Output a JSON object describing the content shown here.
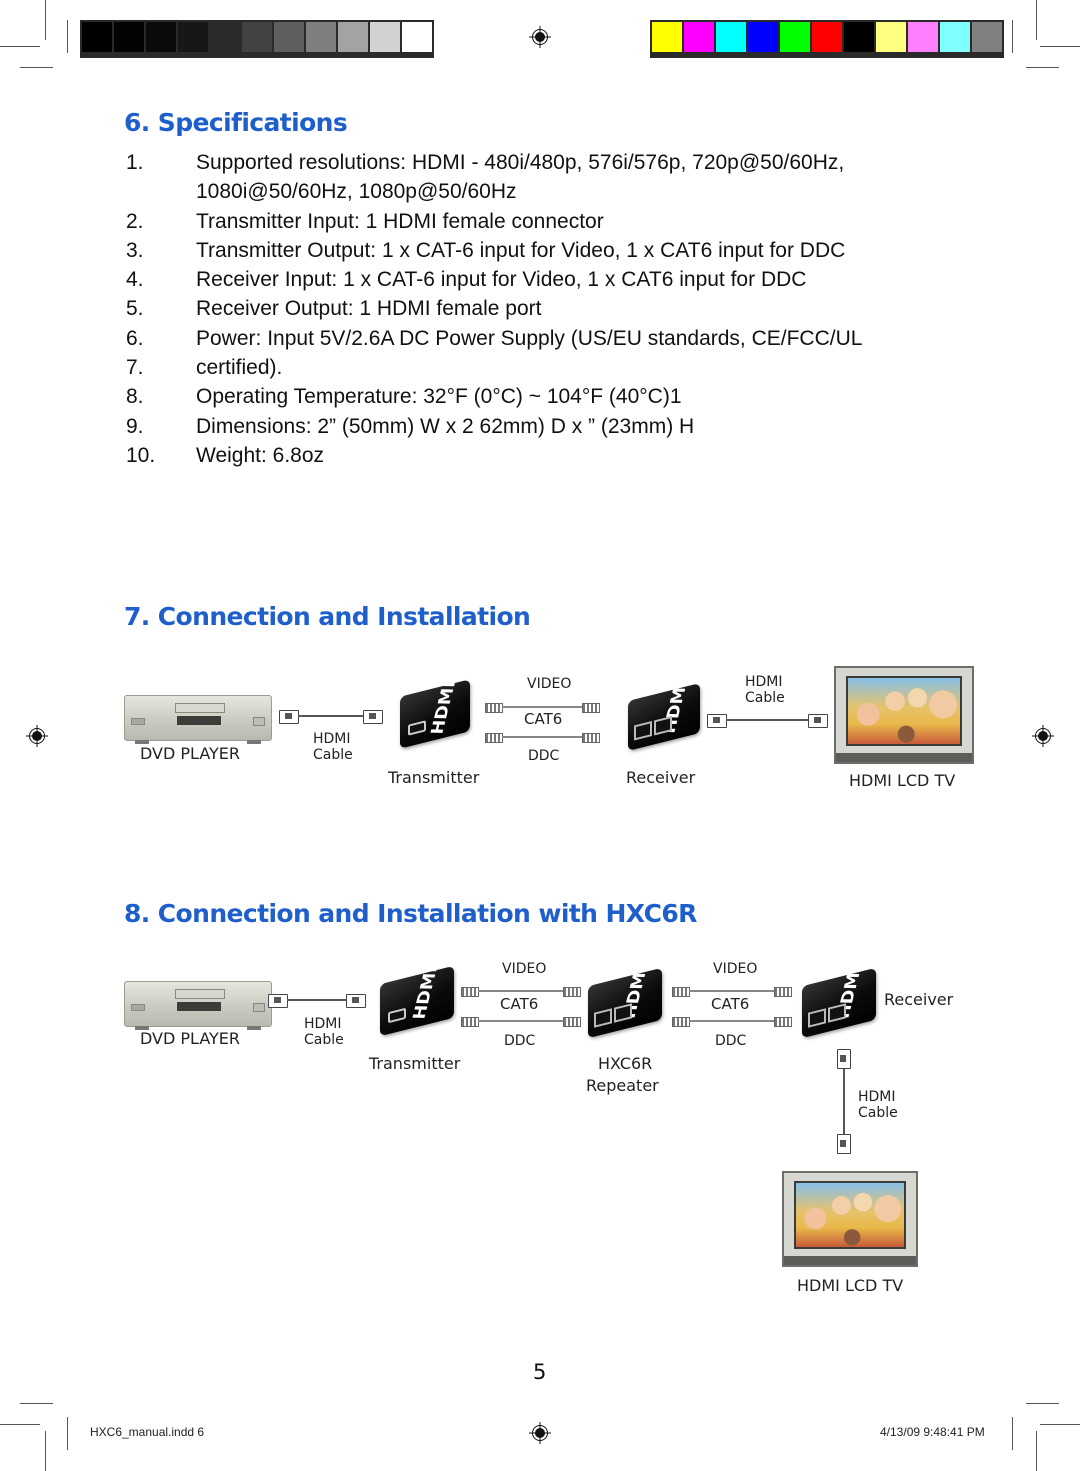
{
  "print_marks": {
    "grayscale_bar": [
      "#000000",
      "#030303",
      "#0a0a0a",
      "#171717",
      "#2b2b2b",
      "#424242",
      "#5e5e5e",
      "#7f7f7f",
      "#a3a3a3",
      "#d2d2d2",
      "#ffffff"
    ],
    "color_bar": [
      "#ffff00",
      "#ff00ff",
      "#00ffff",
      "#0000ff",
      "#00ff00",
      "#ff0000",
      "#000000",
      "#ffff80",
      "#ff80ff",
      "#80ffff",
      "#808080"
    ],
    "registration_icon": "crosshair-target-icon"
  },
  "accent_color": "#1f5fcc",
  "sections": {
    "specifications": {
      "title": "6. Specifications",
      "items": [
        {
          "num": "1.",
          "text": "Supported resolutions: HDMI - 480i/480p, 576i/576p, 720p@50/60Hz,",
          "cont": "1080i@50/60Hz, 1080p@50/60Hz"
        },
        {
          "num": "2.",
          "text": "Transmitter Input: 1 HDMI female connector"
        },
        {
          "num": "3.",
          "text": "Transmitter Output: 1 x CAT-6 input for Video, 1 x CAT6 input for DDC"
        },
        {
          "num": "4.",
          "text": "Receiver Input: 1 x CAT-6 input for Video, 1 x CAT6 input for DDC"
        },
        {
          "num": "5.",
          "text": "Receiver Output: 1 HDMI female port"
        },
        {
          "num": "6.",
          "text": "Power: Input 5V/2.6A DC Power Supply (US/EU standards, CE/FCC/UL"
        },
        {
          "num": "7.",
          "text": " certified)."
        },
        {
          "num": "8.",
          "text": "Operating Temperature: 32°F (0°C) ~ 104°F (40°C)1"
        },
        {
          "num": "9.",
          "text": "Dimensions: 2” (50mm) W x 2  62mm) D x  ” (23mm) H"
        },
        {
          "num": "10.",
          "text": "Weight: 6.8oz"
        }
      ]
    },
    "connection": {
      "title": "7. Connection and Installation",
      "diagram": {
        "dvd_label": "DVD PLAYER",
        "hdmi_cable_1": [
          "HDMI",
          "Cable"
        ],
        "transmitter_label": "Transmitter",
        "video_label": "VIDEO",
        "cat6_label": "CAT6",
        "ddc_label": "DDC",
        "receiver_label": "Receiver",
        "hdmi_cable_2": [
          "HDMI",
          "Cable"
        ],
        "tv_label": "HDMI LCD TV",
        "device_logo": "HDMI"
      }
    },
    "connection_repeater": {
      "title": "8. Connection and Installation with HXC6R",
      "diagram": {
        "dvd_label": "DVD PLAYER",
        "hdmi_cable_1": [
          "HDMI",
          "Cable"
        ],
        "transmitter_label": "Transmitter",
        "video_label_1": "VIDEO",
        "cat6_label_1": "CAT6",
        "ddc_label_1": "DDC",
        "repeater_label": [
          "HXC6R",
          "Repeater"
        ],
        "video_label_2": "VIDEO",
        "cat6_label_2": "CAT6",
        "ddc_label_2": "DDC",
        "receiver_label": "Receiver",
        "hdmi_cable_2": [
          "HDMI",
          "Cable"
        ],
        "tv_label": "HDMI LCD TV",
        "device_logo": "HDMI"
      }
    }
  },
  "footer": {
    "page_number": "5",
    "file_slug": "HXC6_manual.indd   6",
    "timestamp": "4/13/09   9:48:41 PM"
  }
}
